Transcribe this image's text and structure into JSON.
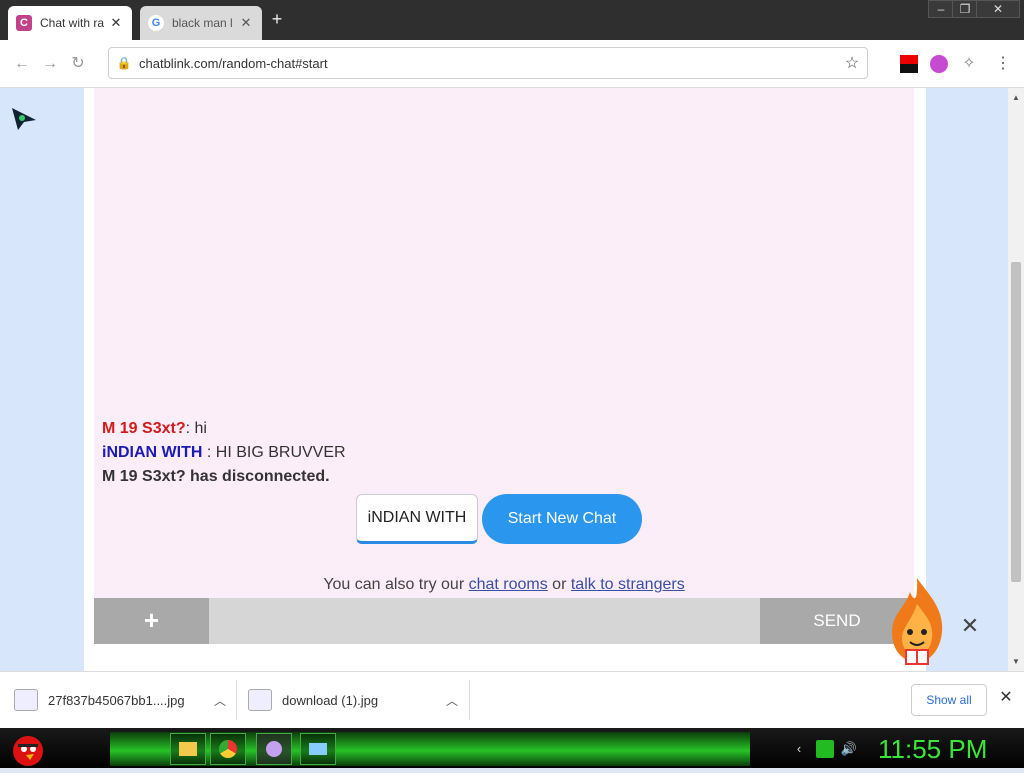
{
  "browser": {
    "tabs": [
      {
        "label": "Chat with ra",
        "favicon": "C"
      },
      {
        "label": "black man l",
        "favicon": "G"
      }
    ],
    "new_tab": "+",
    "url": "chatblink.com/random-chat#start"
  },
  "chat": {
    "messages": [
      {
        "name": "M 19 S3xt?",
        "text": ": hi"
      },
      {
        "name": "iNDIAN WITH ",
        "text": ": HI BIG BRUVVER"
      }
    ],
    "status": "M 19 S3xt? has disconnected.",
    "name_value": "iNDIAN WITH",
    "start_label": "Start New Chat",
    "also_try_prefix": "You can also try our ",
    "chat_rooms_link": "chat rooms",
    "or_text": " or ",
    "strangers_link": "talk to strangers",
    "plus_label": "+",
    "send_label": "SEND",
    "close_label": "✕"
  },
  "downloads": {
    "items": [
      {
        "name": "27f837b45067bb1....jpg"
      },
      {
        "name": "download (1).jpg"
      }
    ],
    "show_all": "Show all"
  },
  "taskbar": {
    "clock": "11:55 PM"
  },
  "colors": {
    "accent": "#2a96ee",
    "name_red": "#d21a1a",
    "name_blue": "#1b1bb5",
    "chat_bg": "#fbeef8",
    "clock": "#39e639"
  }
}
